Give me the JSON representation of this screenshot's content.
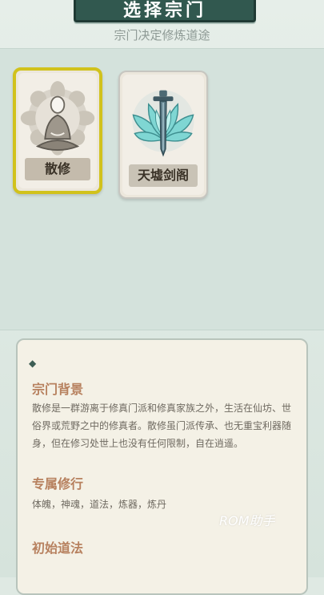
{
  "header": {
    "title": "选择宗门",
    "subtitle": "宗门决定修炼道途"
  },
  "sects": [
    {
      "name": "散修",
      "selected": true,
      "icon": "meditating-cultivator-icon"
    },
    {
      "name": "天墟剑阁",
      "selected": false,
      "icon": "lotus-sword-icon"
    }
  ],
  "details": {
    "background_title": "宗门背景",
    "background_text": "散修是一群游离于修真门派和修真家族之外，生活在仙坊、世俗界或荒野之中的修真者。散修虽门派传承、也无重宝利器随身，但在修习处世上也没有任何限制，自在逍遥。",
    "practice_title": "专属修行",
    "practice_text": "体魄，神魂，道法，炼器，炼丹",
    "skills_title": "初始道法"
  },
  "watermark": "ROM助手",
  "colors": {
    "banner": "#31584f",
    "selected_border": "#d1c21c",
    "section_title": "#b7815f"
  }
}
